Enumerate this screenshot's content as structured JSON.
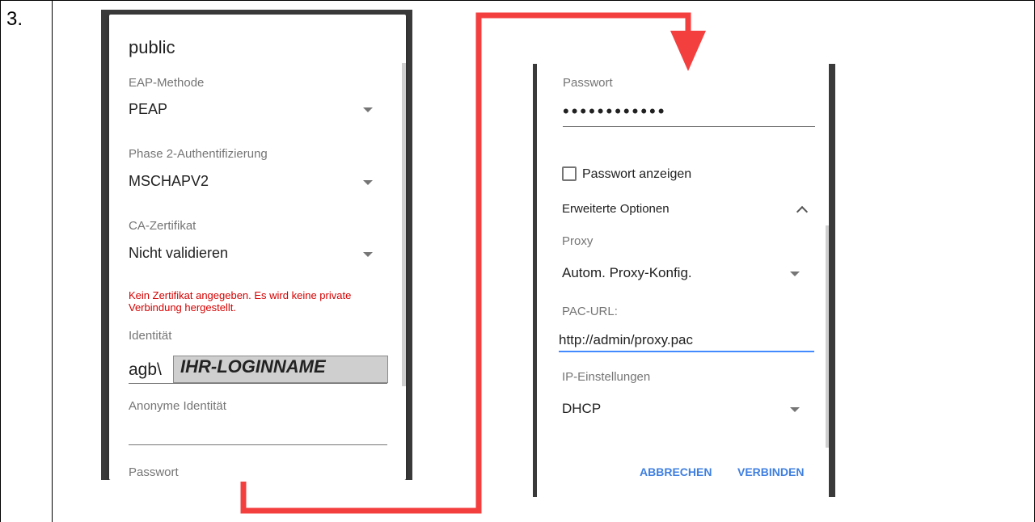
{
  "step_number": "3.",
  "left_dialog": {
    "title": "public",
    "eap_method": {
      "label": "EAP-Methode",
      "value": "PEAP"
    },
    "phase2": {
      "label": "Phase 2-Authentifizierung",
      "value": "MSCHAPV2"
    },
    "ca_cert": {
      "label": "CA-Zertifikat",
      "value": "Nicht validieren"
    },
    "warning": "Kein Zertifikat angegeben. Es wird keine private Verbindung hergestellt.",
    "identity": {
      "label": "Identität",
      "prefix": "agb\\",
      "value": "IHR-LOGINNAME"
    },
    "anon_identity": {
      "label": "Anonyme Identität",
      "value": ""
    },
    "password": {
      "label": "Passwort"
    }
  },
  "right_dialog": {
    "password": {
      "label": "Passwort",
      "value": "••••••••••••"
    },
    "show_password": {
      "label": "Passwort anzeigen",
      "checked": false
    },
    "advanced": {
      "label": "Erweiterte Optionen",
      "expanded": true
    },
    "proxy": {
      "label": "Proxy",
      "value": "Autom. Proxy-Konfig."
    },
    "pac_url": {
      "label": "PAC-URL:",
      "value": "http://admin/proxy.pac"
    },
    "ip_settings": {
      "label": "IP-Einstellungen",
      "value": "DHCP"
    },
    "buttons": {
      "cancel": "ABBRECHEN",
      "connect": "VERBINDEN"
    }
  },
  "colors": {
    "arrow": "#f43f3f",
    "warning": "#d50000",
    "accent": "#448aff",
    "button_text": "#3f7fe0"
  }
}
